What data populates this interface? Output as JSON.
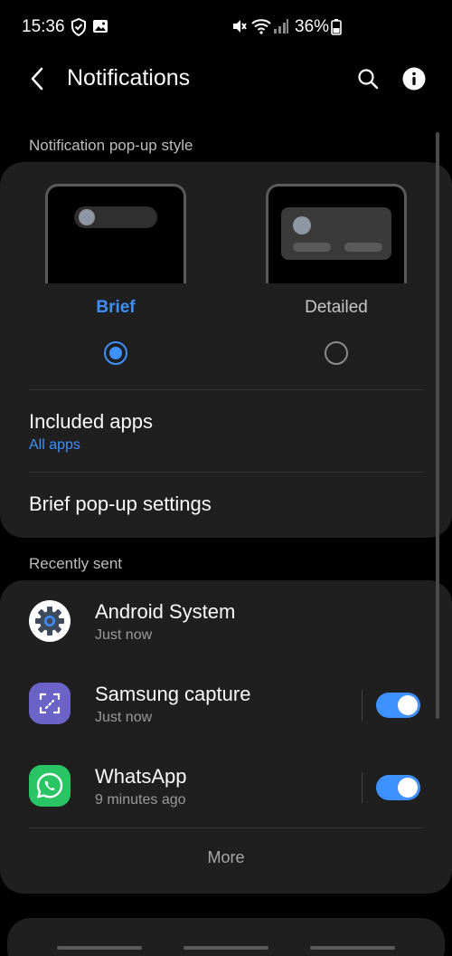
{
  "status_bar": {
    "time": "15:36",
    "battery": "36%"
  },
  "app_bar": {
    "title": "Notifications"
  },
  "popup_style": {
    "section_label": "Notification pop-up style",
    "options": [
      {
        "label": "Brief",
        "selected": true
      },
      {
        "label": "Detailed",
        "selected": false
      }
    ]
  },
  "included_apps": {
    "title": "Included apps",
    "value": "All apps"
  },
  "brief_settings": {
    "title": "Brief pop-up settings"
  },
  "recently_sent": {
    "section_label": "Recently sent",
    "apps": [
      {
        "name": "Android System",
        "time": "Just now",
        "icon": "gear-icon",
        "has_toggle": false
      },
      {
        "name": "Samsung capture",
        "time": "Just now",
        "icon": "samsung-capture-icon",
        "has_toggle": true,
        "enabled": true
      },
      {
        "name": "WhatsApp",
        "time": "9 minutes ago",
        "icon": "whatsapp-icon",
        "has_toggle": true,
        "enabled": true
      }
    ],
    "more_label": "More"
  },
  "colors": {
    "accent": "#3e91ff",
    "card_bg": "#1f1f1f",
    "background": "#000000"
  }
}
